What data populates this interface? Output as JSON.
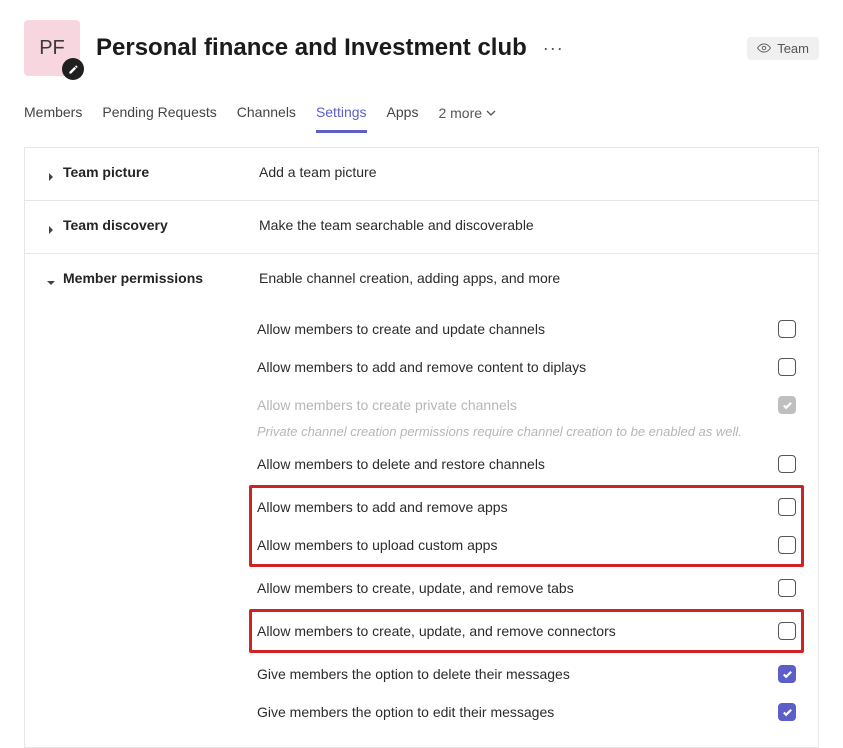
{
  "header": {
    "avatar_initials": "PF",
    "title": "Personal finance and Investment club",
    "team_pill": "Team"
  },
  "tabs": {
    "members": "Members",
    "pending": "Pending Requests",
    "channels": "Channels",
    "settings": "Settings",
    "apps": "Apps",
    "more": "2 more"
  },
  "sections": {
    "picture": {
      "title": "Team picture",
      "desc": "Add a team picture"
    },
    "discovery": {
      "title": "Team discovery",
      "desc": "Make the team searchable and discoverable"
    },
    "permissions": {
      "title": "Member permissions",
      "desc": "Enable channel creation, adding apps, and more"
    }
  },
  "permissions": [
    {
      "label": "Allow members to create and update channels",
      "checked": false,
      "disabled": false,
      "hl": 0
    },
    {
      "label": "Allow members to add and remove content to diplays",
      "checked": false,
      "disabled": false,
      "hl": 0
    },
    {
      "label": "Allow members to create private channels",
      "checked": true,
      "disabled": true,
      "hl": 0,
      "hint": "Private channel creation permissions require channel creation to be enabled as well."
    },
    {
      "label": "Allow members to delete and restore channels",
      "checked": false,
      "disabled": false,
      "hl": 0
    },
    {
      "label": "Allow members to add and remove apps",
      "checked": false,
      "disabled": false,
      "hl": 1
    },
    {
      "label": "Allow members to upload custom apps",
      "checked": false,
      "disabled": false,
      "hl": 1
    },
    {
      "label": "Allow members to create, update, and remove tabs",
      "checked": false,
      "disabled": false,
      "hl": 0
    },
    {
      "label": "Allow members to create, update, and remove connectors",
      "checked": false,
      "disabled": false,
      "hl": 2
    },
    {
      "label": "Give members the option to delete their messages",
      "checked": true,
      "disabled": false,
      "hl": 0
    },
    {
      "label": "Give members the option to edit their messages",
      "checked": true,
      "disabled": false,
      "hl": 0
    }
  ]
}
